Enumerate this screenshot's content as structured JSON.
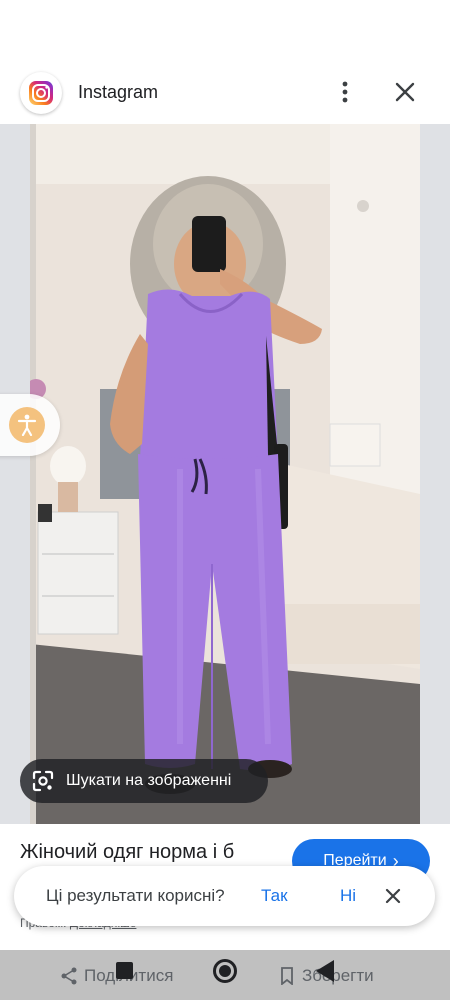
{
  "header": {
    "title": "Instagram",
    "logo_icon": "instagram-logo",
    "more_icon": "more-vert-icon",
    "close_icon": "close-icon"
  },
  "image": {
    "description_icon": "photo",
    "lens_chip": {
      "icon": "google-lens-icon",
      "label": "Шукати на зображенні"
    },
    "accessibility_icon": "accessibility-icon"
  },
  "result": {
    "title": "Жіночий одяг норма і б",
    "visit_label": "Перейти",
    "visit_chevron": "›",
    "rights_prefix": "Правом",
    "rights_more": "Докладніше"
  },
  "feedback": {
    "question": "Ці результати корисні?",
    "yes": "Так",
    "no": "Ні"
  },
  "actions": {
    "share": "Поділитися",
    "save": "Зберегти"
  },
  "colors": {
    "accent": "#1a73e8",
    "outfit": "#a47be0"
  }
}
